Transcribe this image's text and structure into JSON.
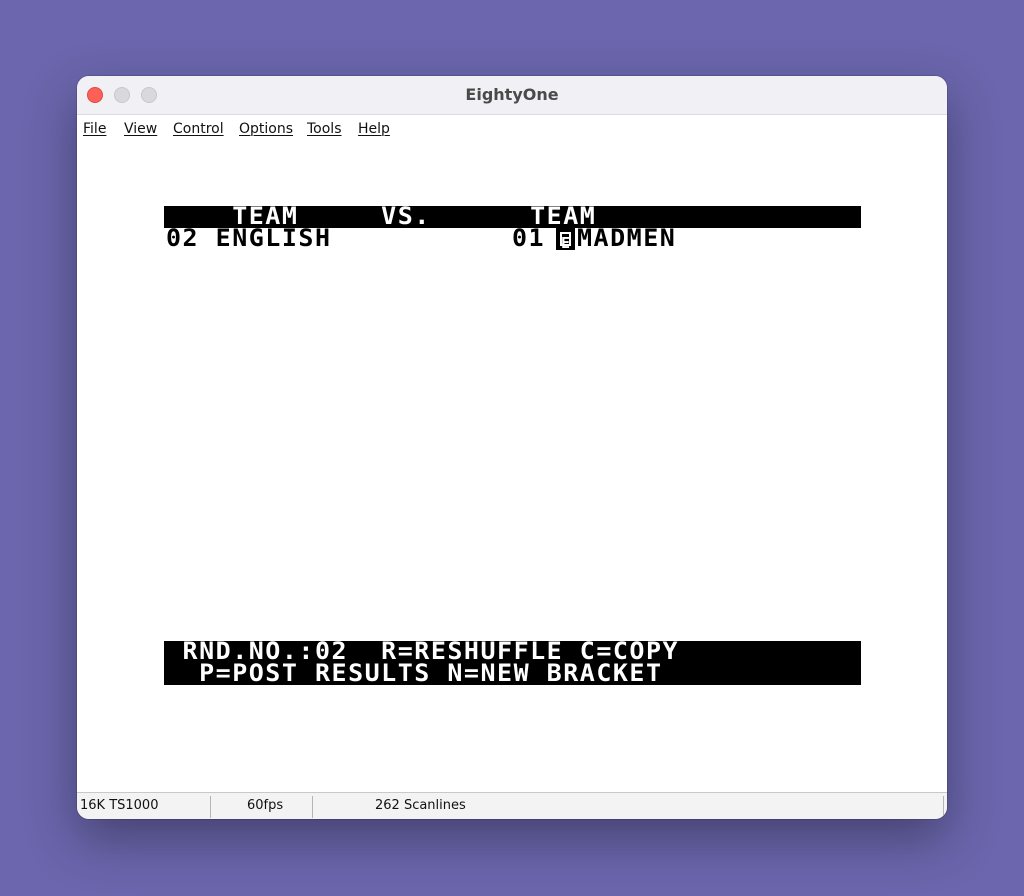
{
  "window": {
    "title": "EightyOne"
  },
  "menu": {
    "items": [
      "File",
      "View",
      "Control",
      "Options",
      "Tools",
      "Help"
    ]
  },
  "screen": {
    "header_line": "    TEAM     VS.      TEAM",
    "match_left": "02 ENGLISH",
    "match_right": "01",
    "cursor_char": "E",
    "match_opponent": "MADMEN",
    "footer_line1": " RND.NO.:02  R=RESHUFFLE C=COPY",
    "footer_line2": "  P=POST RESULTS N=NEW BRACKET"
  },
  "status": {
    "machine": "16K TS1000",
    "fps": "60fps",
    "scanlines": "262 Scanlines"
  },
  "colors": {
    "desktop": "#6b66ad",
    "close": "#fe5f57",
    "screen_ink": "#000000",
    "screen_paper": "#ffffff"
  }
}
